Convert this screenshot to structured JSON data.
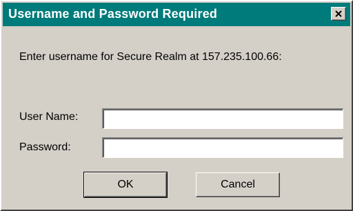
{
  "window": {
    "title": "Username and Password Required",
    "titlebar_color": "#007b7b",
    "face_color": "#d4d0c8",
    "close_icon": "close-x-icon"
  },
  "form": {
    "prompt": "Enter username for Secure Realm at 157.235.100.66:",
    "username_label": "User Name:",
    "username_value": "",
    "password_label": "Password:",
    "password_value": ""
  },
  "buttons": {
    "ok_label": "OK",
    "cancel_label": "Cancel"
  }
}
